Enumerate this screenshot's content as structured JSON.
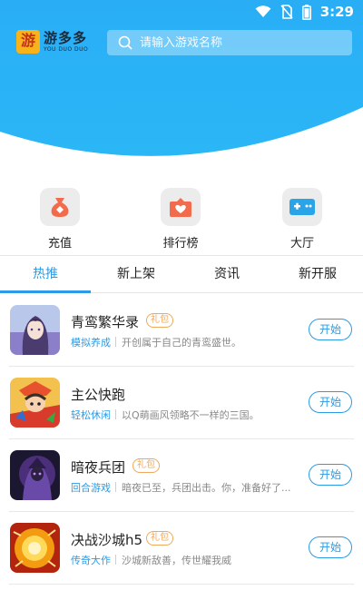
{
  "status": {
    "time": "3:29",
    "icons": [
      "wifi-icon",
      "no-sim-icon",
      "battery-icon"
    ]
  },
  "header": {
    "logo_cn": "游多多",
    "logo_en": "YOU DUO DUO",
    "logo_mark": "游",
    "search_placeholder": "请输入游戏名称",
    "accent": "#2ab0f4"
  },
  "quicknav": [
    {
      "label": "充值",
      "icon": "money-bag-icon",
      "color": "#f26b4d"
    },
    {
      "label": "排行榜",
      "icon": "ranking-heart-icon",
      "color": "#f26b4d"
    },
    {
      "label": "大厅",
      "icon": "gamepad-icon",
      "color": "#2aa4e8"
    }
  ],
  "tabs": [
    {
      "label": "热推",
      "active": true
    },
    {
      "label": "新上架",
      "active": false
    },
    {
      "label": "资讯",
      "active": false
    },
    {
      "label": "新开服",
      "active": false
    }
  ],
  "games": [
    {
      "name": "青鸾繁华录",
      "gift": "礼包",
      "category": "模拟养成",
      "desc": "开创属于自己的青鸾盛世。",
      "start": "开始"
    },
    {
      "name": "主公快跑",
      "gift": "",
      "category": "轻松休闲",
      "desc": "以Q萌画风领略不一样的三国。",
      "start": "开始"
    },
    {
      "name": "暗夜兵团",
      "gift": "礼包",
      "category": "回合游戏",
      "desc": "暗夜已至，兵团出击。你，准备好了...",
      "start": "开始"
    },
    {
      "name": "决战沙城h5",
      "gift": "礼包",
      "category": "传奇大作",
      "desc": "沙城新敌善，传世耀我威",
      "start": "开始"
    }
  ]
}
